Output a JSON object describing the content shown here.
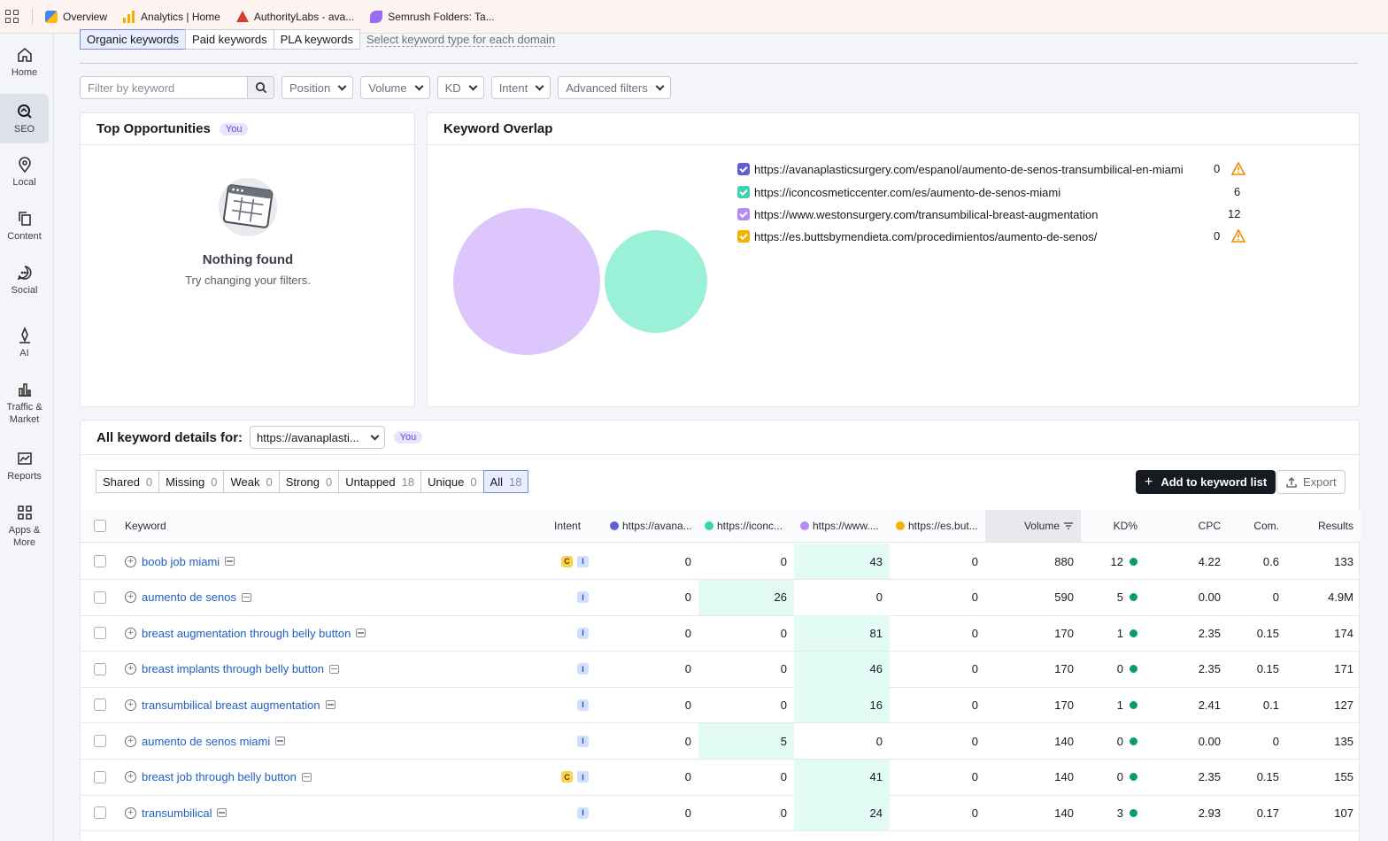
{
  "bookmarks": [
    {
      "label": "Overview",
      "icon": "google-ads-icon"
    },
    {
      "label": "Analytics | Home",
      "icon": "analytics-icon"
    },
    {
      "label": "AuthorityLabs - ava...",
      "icon": "authoritylabs-icon"
    },
    {
      "label": "Semrush Folders: Ta...",
      "icon": "semrush-icon"
    }
  ],
  "sidebar": [
    {
      "label": "Home",
      "icon": "home-icon"
    },
    {
      "label": "SEO",
      "icon": "seo-icon",
      "active": true
    },
    {
      "label": "Local",
      "icon": "location-pin-icon"
    },
    {
      "label": "Content",
      "icon": "content-icon"
    },
    {
      "label": "Social",
      "icon": "chat-bubble-icon"
    },
    {
      "label": "AI",
      "icon": "ai-icon"
    },
    {
      "label": "Traffic & Market",
      "icon": "bar-chart-icon"
    },
    {
      "label": "Reports",
      "icon": "reports-icon"
    },
    {
      "label": "Apps & More",
      "icon": "apps-grid-icon"
    }
  ],
  "keyword_types": {
    "organic": "Organic keywords",
    "paid": "Paid keywords",
    "pla": "PLA keywords",
    "hint": "Select keyword type for each domain"
  },
  "filters": {
    "keyword_placeholder": "Filter by keyword",
    "position": "Position",
    "volume": "Volume",
    "kd": "KD",
    "intent": "Intent",
    "advanced": "Advanced filters"
  },
  "top_opportunities": {
    "title": "Top Opportunities",
    "badge": "You",
    "empty_title": "Nothing found",
    "empty_sub": "Try changing your filters."
  },
  "keyword_overlap": {
    "title": "Keyword Overlap",
    "colors": [
      "#5e5fd8",
      "#3fd2b0",
      "#b78af5",
      "#f5b301"
    ],
    "domains": [
      {
        "url": "https://avanaplasticsurgery.com/espanol/aumento-de-senos-transumbilical-en-miami",
        "count": "0",
        "warning": true
      },
      {
        "url": "https://iconcosmeticcenter.com/es/aumento-de-senos-miami",
        "count": "6",
        "warning": false
      },
      {
        "url": "https://www.westonsurgery.com/transumbilical-breast-augmentation",
        "count": "12",
        "warning": false
      },
      {
        "url": "https://es.buttsbymendieta.com/procedimientos/aumento-de-senos/",
        "count": "0",
        "warning": true
      }
    ]
  },
  "details": {
    "title": "All keyword details for:",
    "domain": "https://avanaplasti...",
    "badge": "You",
    "tabs": [
      {
        "label": "Shared",
        "count": "0"
      },
      {
        "label": "Missing",
        "count": "0"
      },
      {
        "label": "Weak",
        "count": "0"
      },
      {
        "label": "Strong",
        "count": "0"
      },
      {
        "label": "Untapped",
        "count": "18"
      },
      {
        "label": "Unique",
        "count": "0"
      },
      {
        "label": "All",
        "count": "18",
        "active": true
      }
    ],
    "add_button": "Add to keyword list",
    "export_button": "Export"
  },
  "table": {
    "headers": {
      "keyword": "Keyword",
      "intent": "Intent",
      "d1": "https://avana...",
      "d2": "https://iconc...",
      "d3": "https://www....",
      "d4": "https://es.but...",
      "volume": "Volume",
      "kd": "KD%",
      "cpc": "CPC",
      "com": "Com.",
      "results": "Results"
    },
    "rows": [
      {
        "keyword": "boob job miami",
        "intent": [
          "C",
          "I"
        ],
        "d1": "0",
        "d2": "0",
        "d3": "43",
        "d4": "0",
        "hl": "d3",
        "volume": "880",
        "kd": "12",
        "cpc": "4.22",
        "com": "0.6",
        "results": "133"
      },
      {
        "keyword": "aumento de senos",
        "intent": [
          "I"
        ],
        "d1": "0",
        "d2": "26",
        "d3": "0",
        "d4": "0",
        "hl": "d2",
        "volume": "590",
        "kd": "5",
        "cpc": "0.00",
        "com": "0",
        "results": "4.9M"
      },
      {
        "keyword": "breast augmentation through belly button",
        "intent": [
          "I"
        ],
        "d1": "0",
        "d2": "0",
        "d3": "81",
        "d4": "0",
        "hl": "d3",
        "volume": "170",
        "kd": "1",
        "cpc": "2.35",
        "com": "0.15",
        "results": "174"
      },
      {
        "keyword": "breast implants through belly button",
        "intent": [
          "I"
        ],
        "d1": "0",
        "d2": "0",
        "d3": "46",
        "d4": "0",
        "hl": "d3",
        "volume": "170",
        "kd": "0",
        "cpc": "2.35",
        "com": "0.15",
        "results": "171"
      },
      {
        "keyword": "transumbilical breast augmentation",
        "intent": [
          "I"
        ],
        "d1": "0",
        "d2": "0",
        "d3": "16",
        "d4": "0",
        "hl": "d3",
        "volume": "170",
        "kd": "1",
        "cpc": "2.41",
        "com": "0.1",
        "results": "127"
      },
      {
        "keyword": "aumento de senos miami",
        "intent": [
          "I"
        ],
        "d1": "0",
        "d2": "5",
        "d3": "0",
        "d4": "0",
        "hl": "d2",
        "volume": "140",
        "kd": "0",
        "cpc": "0.00",
        "com": "0",
        "results": "135"
      },
      {
        "keyword": "breast job through belly button",
        "intent": [
          "C",
          "I"
        ],
        "d1": "0",
        "d2": "0",
        "d3": "41",
        "d4": "0",
        "hl": "d3",
        "volume": "140",
        "kd": "0",
        "cpc": "2.35",
        "com": "0.15",
        "results": "155"
      },
      {
        "keyword": "transumbilical",
        "intent": [
          "I"
        ],
        "d1": "0",
        "d2": "0",
        "d3": "24",
        "d4": "0",
        "hl": "d3",
        "volume": "140",
        "kd": "3",
        "cpc": "2.93",
        "com": "0.17",
        "results": "107"
      }
    ]
  }
}
